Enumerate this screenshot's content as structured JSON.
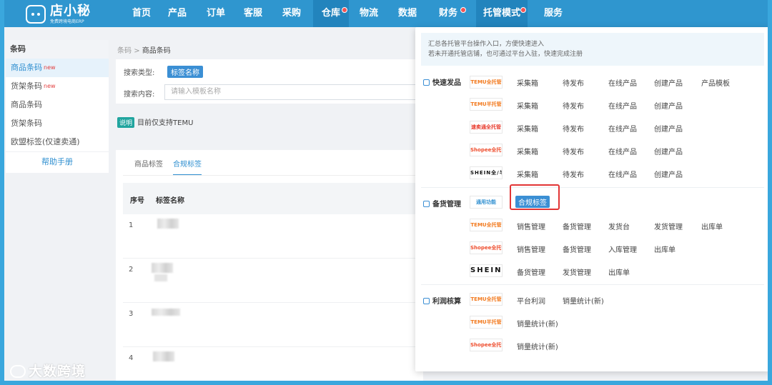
{
  "brand": {
    "name": "店小秘",
    "tagline": "免费跨境电商ERP"
  },
  "nav": {
    "items": [
      "首页",
      "产品",
      "订单",
      "客服",
      "采购",
      "仓库",
      "物流",
      "数据",
      "财务",
      "托管模式",
      "服务"
    ]
  },
  "sidebar": {
    "title": "条码",
    "items": [
      "商品条码",
      "货架条码",
      "商品条码",
      "货架条码",
      "欧盟标签(仅速卖通)"
    ],
    "new_badge": "new",
    "help": "帮助手册"
  },
  "breadcrumb": {
    "parent": "条码",
    "separator": ">",
    "current": "商品条码"
  },
  "search": {
    "type_label": "搜索类型:",
    "type_value": "标签名称",
    "content_label": "搜索内容:",
    "placeholder": "请输入模板名称"
  },
  "note": {
    "tag": "说明",
    "text": "目前仅支持TEMU"
  },
  "tabs": [
    "商品标签",
    "合规标签"
  ],
  "table": {
    "columns": [
      "序号",
      "标签名称"
    ],
    "rows": [
      "1",
      "2",
      "3",
      "4"
    ]
  },
  "panel": {
    "info_line1": "汇总各托管平台操作入口，方便快速进入",
    "info_line2": "若未开通托管店铺，也可通过平台入驻，快速完成注册",
    "sections": {
      "quick": "快速发品",
      "stock": "备货管理",
      "profit": "利润核算"
    },
    "logos": {
      "temu_full": "TEMU全托管",
      "temu_half": "TEMU半托管",
      "aliexpress": "速卖通全托管",
      "shopee": "Shopee全托管",
      "shein_full": "SHEIN全/半托管",
      "general": "通用功能",
      "shein": "SHEIN"
    },
    "links": {
      "caiji": "采集箱",
      "daifabu": "待发布",
      "zaixian": "在线产品",
      "chuangjian": "创建产品",
      "moban": "产品模板",
      "hegui": "合规标签",
      "xiaoshou": "销售管理",
      "beihuo": "备货管理",
      "fahuotai": "发货台",
      "fahuoguanli": "发货管理",
      "chukudan": "出库单",
      "rukuguanli": "入库管理",
      "pingtailirun": "平台利润",
      "xiaoliang": "销量统计(新)"
    }
  },
  "watermark": "大数跨境"
}
